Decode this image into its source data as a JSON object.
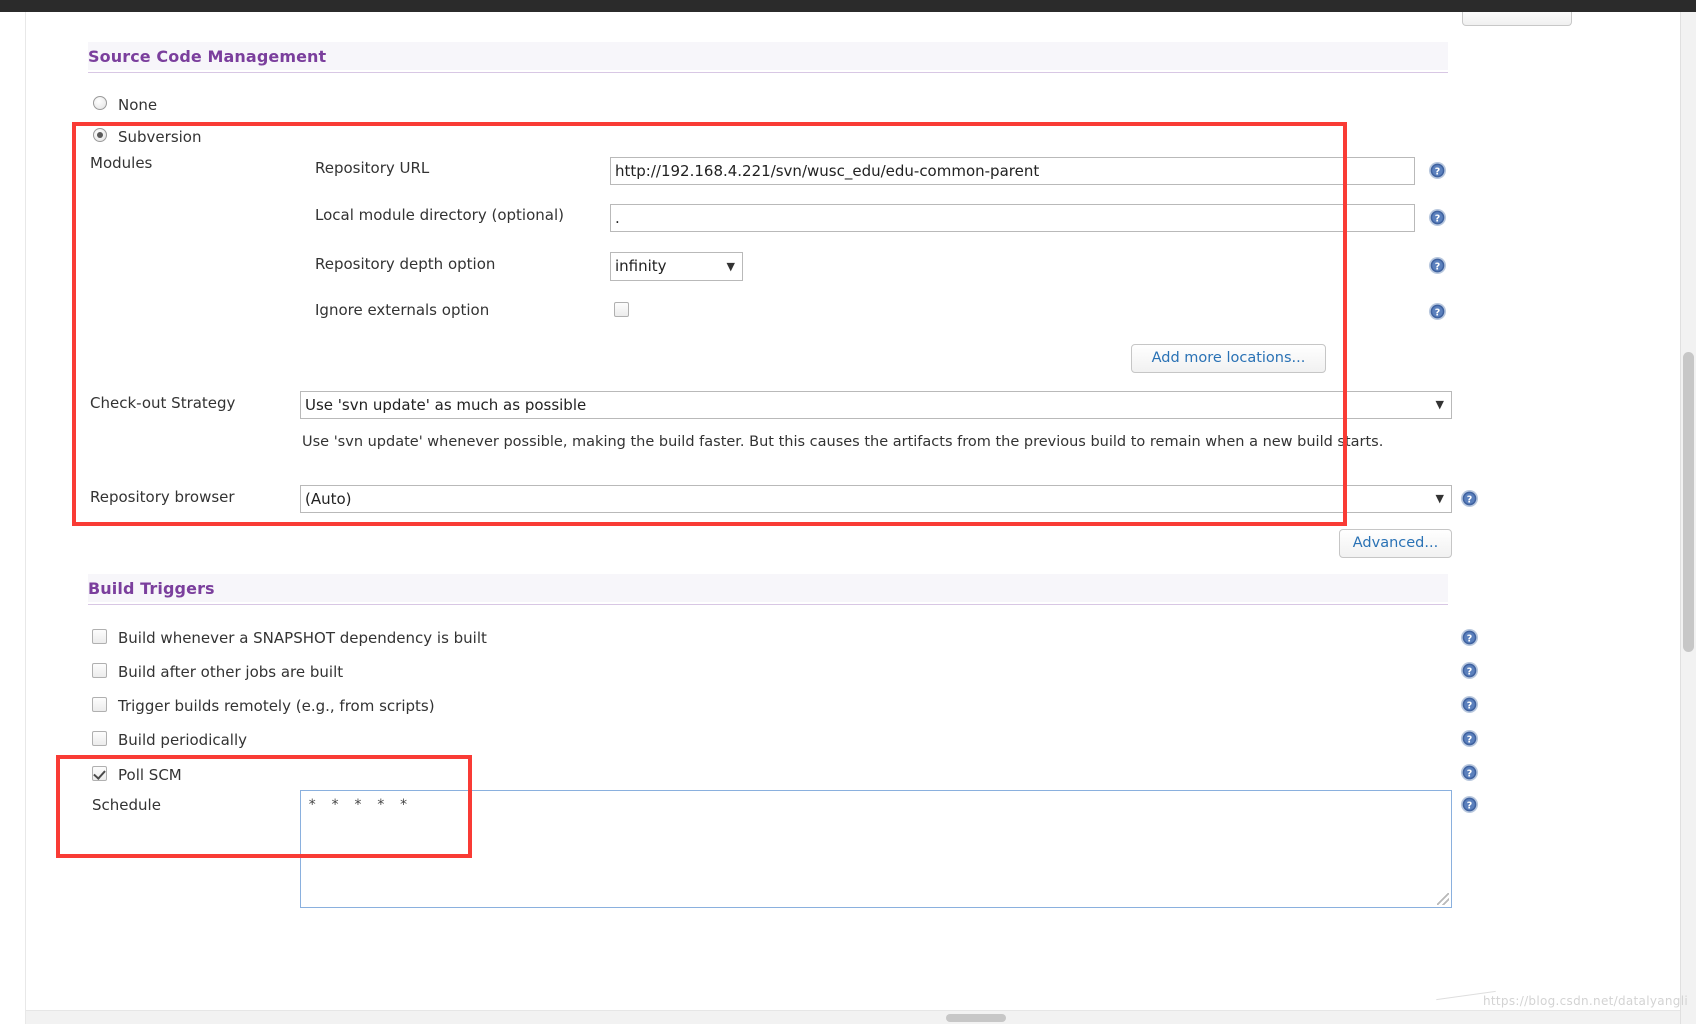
{
  "sections": {
    "scm": {
      "title": "Source Code Management",
      "options": [
        {
          "label": "None",
          "checked": false
        },
        {
          "label": "Subversion",
          "checked": true
        }
      ],
      "modules_label": "Modules",
      "fields": [
        {
          "label": "Repository URL",
          "value": "http://192.168.4.221/svn/wusc_edu/edu-common-parent"
        },
        {
          "label": "Local module directory (optional)",
          "value": "."
        }
      ],
      "depth": {
        "label": "Repository depth option",
        "value": "infinity"
      },
      "ignore_externals": {
        "label": "Ignore externals option",
        "checked": false
      },
      "add_more_button": "Add more locations...",
      "checkout_strategy": {
        "label": "Check-out Strategy",
        "value": "Use 'svn update' as much as possible",
        "description": "Use 'svn update' whenever possible, making the build faster. But this causes the artifacts from the previous build to remain when a new build starts."
      },
      "repository_browser": {
        "label": "Repository browser",
        "value": "(Auto)"
      },
      "advanced_button": "Advanced..."
    },
    "build_triggers": {
      "title": "Build Triggers",
      "items": [
        {
          "label": "Build whenever a SNAPSHOT dependency is built",
          "checked": false
        },
        {
          "label": "Build after other jobs are built",
          "checked": false
        },
        {
          "label": "Trigger builds remotely (e.g., from scripts)",
          "checked": false
        },
        {
          "label": "Build periodically",
          "checked": false
        },
        {
          "label": "Poll SCM",
          "checked": true
        }
      ],
      "schedule": {
        "label": "Schedule",
        "value": "* * * * *"
      }
    }
  },
  "icons": {
    "help": "?",
    "dropdown_arrow": "▼"
  },
  "colors": {
    "heading": "#7b3f9d",
    "annotation": "#f93b35",
    "link": "#2a72b5",
    "help_icon": "#4a6ea9"
  },
  "watermark": "https://blog.csdn.net/datalyangli"
}
